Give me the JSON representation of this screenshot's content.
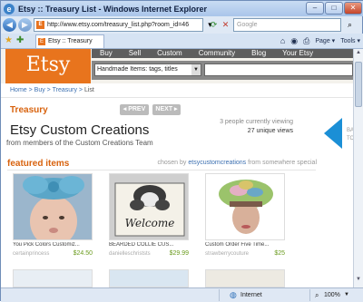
{
  "window": {
    "title": "Etsy :: Treasury List - Windows Internet Explorer"
  },
  "address": {
    "url": "http://www.etsy.com/treasury_list.php?room_id=46",
    "search_placeholder": "Google"
  },
  "tab": {
    "label": "Etsy :: Treasury List"
  },
  "toolbar": {
    "page_label": "Page",
    "tools_label": "Tools"
  },
  "etsy": {
    "logo": "Etsy",
    "nav": [
      "Buy",
      "Sell",
      "Custom",
      "Community",
      "Blog",
      "Your Etsy"
    ],
    "search_select": "Handmade Items: tags, titles",
    "breadcrumb": {
      "home": "Home",
      "buy": "Buy",
      "treasury": "Treasury",
      "list": "List"
    },
    "section_title": "Treasury",
    "prev_label": "PREV",
    "next_label": "NEXT",
    "list_title": "Etsy Custom Creations",
    "list_subtitle": "from members of the Custom Creations Team",
    "viewing": "3 people currently viewing",
    "unique_views": "27 unique views",
    "side_label_1": "BA",
    "side_label_2": "TO",
    "featured_label": "featured items",
    "chosen_by_prefix": "chosen by",
    "chosen_by_user": "etsycustomcreations",
    "chosen_from": "from",
    "chosen_place": "somewhere special"
  },
  "items": [
    {
      "name": "You Pick Colors Customiz...",
      "shop": "certainprincess",
      "price": "$24.50",
      "image": "baby-with-bow-photo"
    },
    {
      "name": "BEARDED COLLIE CUS...",
      "shop": "danielleschriststs",
      "price": "$29.99",
      "image": "dog-welcome-sign"
    },
    {
      "name": "Custom Order Five Time...",
      "shop": "strawberrycouture",
      "price": "$25",
      "image": "knit-hat-mannequin"
    }
  ],
  "status": {
    "zone": "Internet",
    "zoom": "100%"
  },
  "colors": {
    "etsy_orange": "#e8741d",
    "link_blue": "#3b6fb0",
    "price_green": "#6b9b1f"
  }
}
